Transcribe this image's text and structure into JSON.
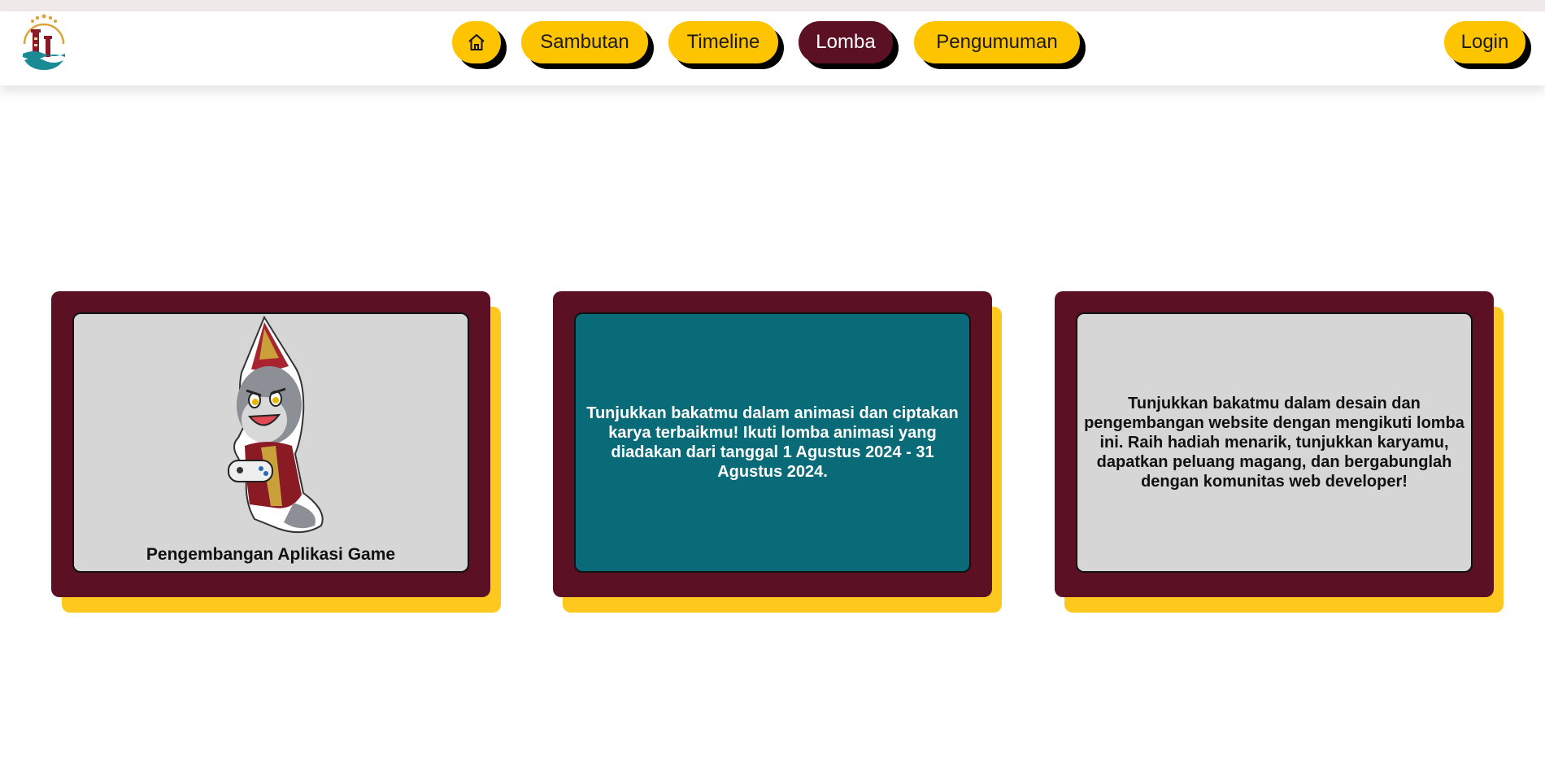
{
  "nav": {
    "items": [
      {
        "label": "",
        "icon": "home-icon"
      },
      {
        "label": "Sambutan"
      },
      {
        "label": "Timeline"
      },
      {
        "label": "Lomba"
      },
      {
        "label": "Pengumuman"
      }
    ],
    "login_label": "Login",
    "active": "Lomba"
  },
  "colors": {
    "accent_yellow": "#ffc400",
    "maroon": "#5c1024",
    "teal": "#0a6b78",
    "card_grey": "#d6d6d6"
  },
  "cards": [
    {
      "title": "Pengembangan Aplikasi Game",
      "image": "mascot-gamer"
    },
    {
      "text": "Tunjukkan bakatmu dalam animasi dan ciptakan karya terbaikmu! Ikuti lomba animasi yang diadakan dari tanggal 1 Agustus 2024 - 31 Agustus 2024."
    },
    {
      "text": "Tunjukkan bakatmu dalam desain dan pengembangan website dengan mengikuti lomba ini. Raih hadiah menarik, tunjukkan karyamu, dapatkan peluang magang, dan bergabunglah dengan komunitas web developer!"
    }
  ]
}
